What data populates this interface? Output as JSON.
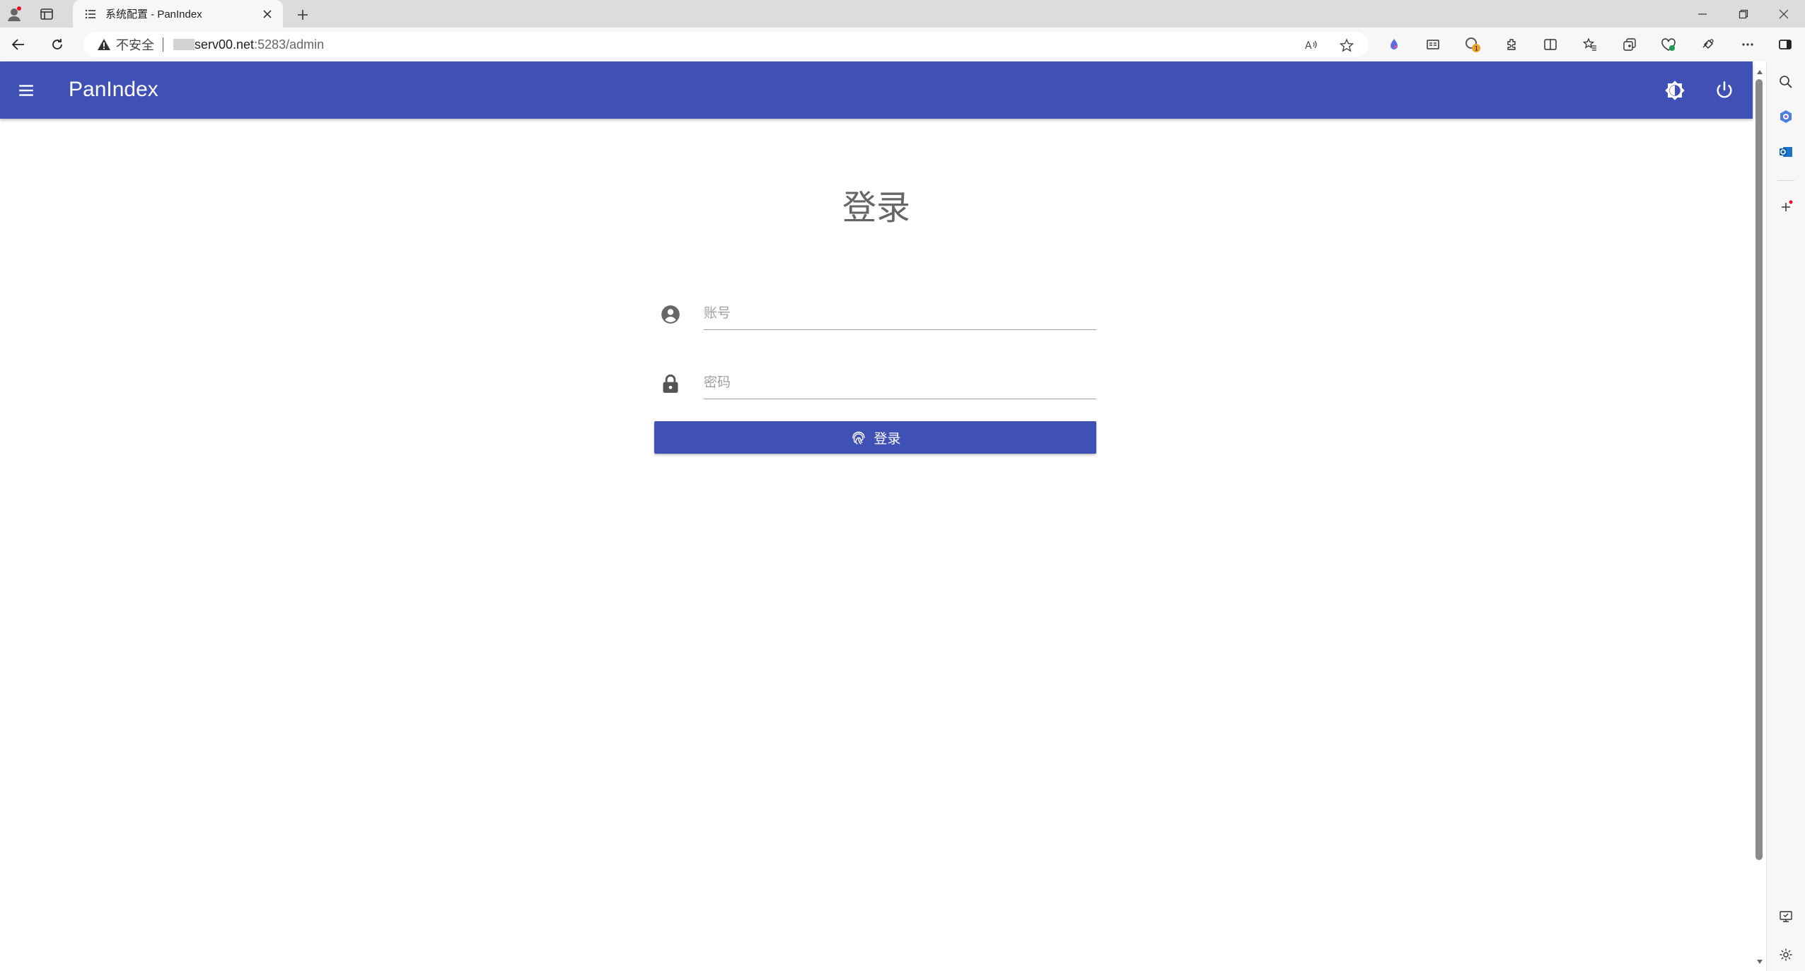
{
  "browser": {
    "tab_title": "系统配置 - PanIndex",
    "insecure_label": "不安全",
    "url_host": "serv00.net",
    "url_path": ":5283/admin",
    "extension_badge": "1"
  },
  "app": {
    "brand": "PanIndex",
    "accent_color": "#3f51b5"
  },
  "login": {
    "title": "登录",
    "username_placeholder": "账号",
    "password_placeholder": "密码",
    "username_value": "",
    "password_value": "",
    "submit_label": "登录"
  },
  "icons": {
    "menu": "menu-icon",
    "theme": "brightness-icon",
    "power": "power-icon",
    "user": "account-circle-icon",
    "lock": "lock-icon",
    "fingerprint": "fingerprint-icon"
  }
}
